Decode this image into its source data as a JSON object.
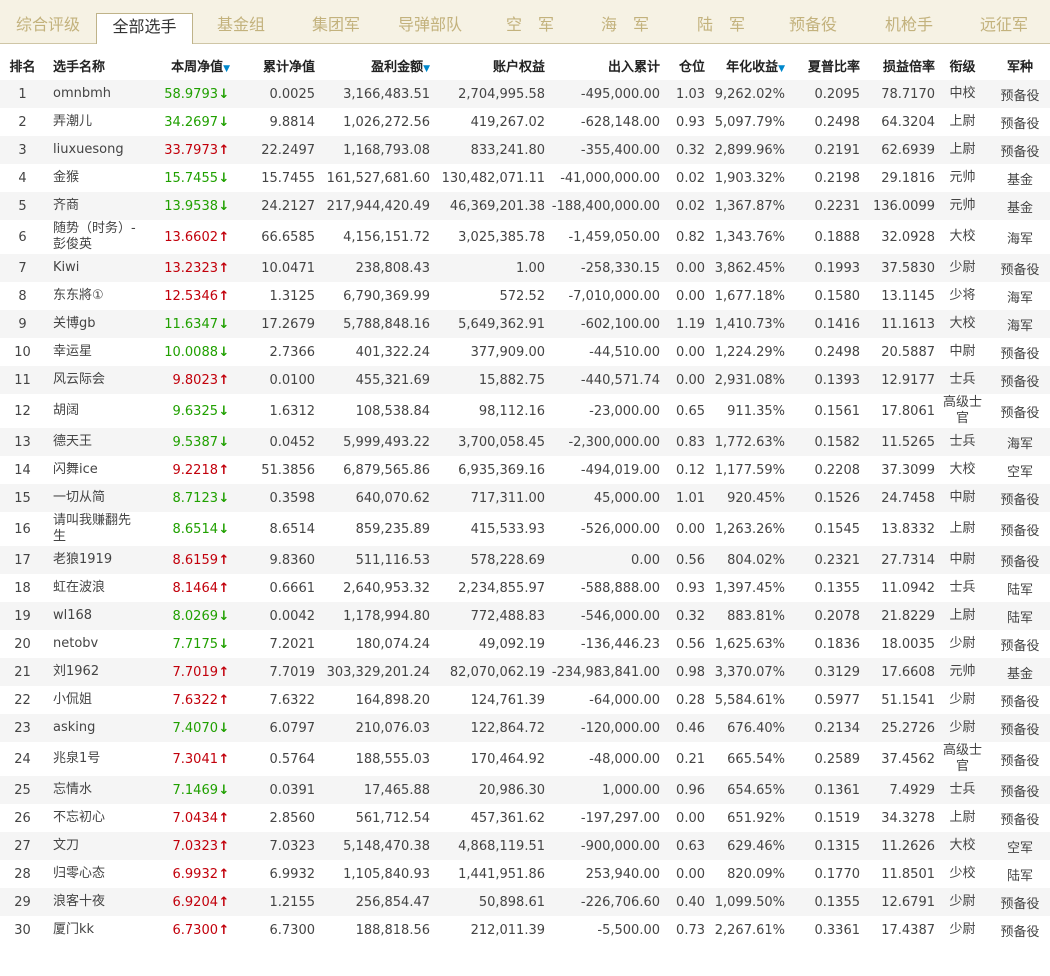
{
  "tabs": [
    {
      "label": "综合评级",
      "active": false
    },
    {
      "label": "全部选手",
      "active": true
    },
    {
      "label": "基金组",
      "active": false
    },
    {
      "label": "集团军",
      "active": false
    },
    {
      "label": "导弹部队",
      "active": false
    },
    {
      "label": "空　军",
      "active": false
    },
    {
      "label": "海　军",
      "active": false
    },
    {
      "label": "陆　军",
      "active": false
    },
    {
      "label": "预备役",
      "active": false
    },
    {
      "label": "机枪手",
      "active": false
    },
    {
      "label": "远征军",
      "active": false
    }
  ],
  "table": {
    "headers": {
      "rank": "排名",
      "name": "选手名称",
      "weekly_nav": "本周净值",
      "cum_nav": "累计净值",
      "profit": "盈利金额",
      "equity": "账户权益",
      "inout": "出入累计",
      "position": "仓位",
      "annual": "年化收益",
      "sharpe": "夏普比率",
      "pl_ratio": "损益倍率",
      "rank_title": "衔级",
      "branch": "军种"
    },
    "sort_icon": "▼",
    "rows": [
      {
        "rank": "1",
        "name": "omnbmh",
        "weekly_nav": "58.9793",
        "trend": "down",
        "cum_nav": "0.0025",
        "profit": "3,166,483.51",
        "equity": "2,704,995.58",
        "inout": "-495,000.00",
        "position": "1.03",
        "annual": "9,262.02%",
        "sharpe": "0.2095",
        "pl_ratio": "78.7170",
        "rank_title": "中校",
        "branch": "预备役"
      },
      {
        "rank": "2",
        "name": "弄潮儿",
        "weekly_nav": "34.2697",
        "trend": "down",
        "cum_nav": "9.8814",
        "profit": "1,026,272.56",
        "equity": "419,267.02",
        "inout": "-628,148.00",
        "position": "0.93",
        "annual": "5,097.79%",
        "sharpe": "0.2498",
        "pl_ratio": "64.3204",
        "rank_title": "上尉",
        "branch": "预备役"
      },
      {
        "rank": "3",
        "name": "liuxuesong",
        "weekly_nav": "33.7973",
        "trend": "up",
        "cum_nav": "22.2497",
        "profit": "1,168,793.08",
        "equity": "833,241.80",
        "inout": "-355,400.00",
        "position": "0.32",
        "annual": "2,899.96%",
        "sharpe": "0.2191",
        "pl_ratio": "62.6939",
        "rank_title": "上尉",
        "branch": "预备役"
      },
      {
        "rank": "4",
        "name": "金猴",
        "weekly_nav": "15.7455",
        "trend": "down",
        "cum_nav": "15.7455",
        "profit": "161,527,681.60",
        "equity": "130,482,071.11",
        "inout": "-41,000,000.00",
        "position": "0.02",
        "annual": "1,903.32%",
        "sharpe": "0.2198",
        "pl_ratio": "29.1816",
        "rank_title": "元帅",
        "branch": "基金"
      },
      {
        "rank": "5",
        "name": "齐商",
        "weekly_nav": "13.9538",
        "trend": "down",
        "cum_nav": "24.2127",
        "profit": "217,944,420.49",
        "equity": "46,369,201.38",
        "inout": "-188,400,000.00",
        "position": "0.02",
        "annual": "1,367.87%",
        "sharpe": "0.2231",
        "pl_ratio": "136.0099",
        "rank_title": "元帅",
        "branch": "基金"
      },
      {
        "rank": "6",
        "name": "随势（时务）-彭俊英",
        "weekly_nav": "13.6602",
        "trend": "up",
        "cum_nav": "66.6585",
        "profit": "4,156,151.72",
        "equity": "3,025,385.78",
        "inout": "-1,459,050.00",
        "position": "0.82",
        "annual": "1,343.76%",
        "sharpe": "0.1888",
        "pl_ratio": "32.0928",
        "rank_title": "大校",
        "branch": "海军"
      },
      {
        "rank": "7",
        "name": "Kiwi",
        "weekly_nav": "13.2323",
        "trend": "up",
        "cum_nav": "10.0471",
        "profit": "238,808.43",
        "equity": "1.00",
        "inout": "-258,330.15",
        "position": "0.00",
        "annual": "3,862.45%",
        "sharpe": "0.1993",
        "pl_ratio": "37.5830",
        "rank_title": "少尉",
        "branch": "预备役"
      },
      {
        "rank": "8",
        "name": "东东將①",
        "weekly_nav": "12.5346",
        "trend": "up",
        "cum_nav": "1.3125",
        "profit": "6,790,369.99",
        "equity": "572.52",
        "inout": "-7,010,000.00",
        "position": "0.00",
        "annual": "1,677.18%",
        "sharpe": "0.1580",
        "pl_ratio": "13.1145",
        "rank_title": "少将",
        "branch": "海军"
      },
      {
        "rank": "9",
        "name": "关博gb",
        "weekly_nav": "11.6347",
        "trend": "down",
        "cum_nav": "17.2679",
        "profit": "5,788,848.16",
        "equity": "5,649,362.91",
        "inout": "-602,100.00",
        "position": "1.19",
        "annual": "1,410.73%",
        "sharpe": "0.1416",
        "pl_ratio": "11.1613",
        "rank_title": "大校",
        "branch": "海军"
      },
      {
        "rank": "10",
        "name": "幸运星",
        "weekly_nav": "10.0088",
        "trend": "down",
        "cum_nav": "2.7366",
        "profit": "401,322.24",
        "equity": "377,909.00",
        "inout": "-44,510.00",
        "position": "0.00",
        "annual": "1,224.29%",
        "sharpe": "0.2498",
        "pl_ratio": "20.5887",
        "rank_title": "中尉",
        "branch": "预备役"
      },
      {
        "rank": "11",
        "name": "风云际会",
        "weekly_nav": "9.8023",
        "trend": "up",
        "cum_nav": "0.0100",
        "profit": "455,321.69",
        "equity": "15,882.75",
        "inout": "-440,571.74",
        "position": "0.00",
        "annual": "2,931.08%",
        "sharpe": "0.1393",
        "pl_ratio": "12.9177",
        "rank_title": "士兵",
        "branch": "预备役"
      },
      {
        "rank": "12",
        "name": "胡阔",
        "weekly_nav": "9.6325",
        "trend": "down",
        "cum_nav": "1.6312",
        "profit": "108,538.84",
        "equity": "98,112.16",
        "inout": "-23,000.00",
        "position": "0.65",
        "annual": "911.35%",
        "sharpe": "0.1561",
        "pl_ratio": "17.8061",
        "rank_title": "高级士官",
        "branch": "预备役"
      },
      {
        "rank": "13",
        "name": "德天王",
        "weekly_nav": "9.5387",
        "trend": "down",
        "cum_nav": "0.0452",
        "profit": "5,999,493.22",
        "equity": "3,700,058.45",
        "inout": "-2,300,000.00",
        "position": "0.83",
        "annual": "1,772.63%",
        "sharpe": "0.1582",
        "pl_ratio": "11.5265",
        "rank_title": "士兵",
        "branch": "海军"
      },
      {
        "rank": "14",
        "name": "闪舞ice",
        "weekly_nav": "9.2218",
        "trend": "up",
        "cum_nav": "51.3856",
        "profit": "6,879,565.86",
        "equity": "6,935,369.16",
        "inout": "-494,019.00",
        "position": "0.12",
        "annual": "1,177.59%",
        "sharpe": "0.2208",
        "pl_ratio": "37.3099",
        "rank_title": "大校",
        "branch": "空军"
      },
      {
        "rank": "15",
        "name": "一切从简",
        "weekly_nav": "8.7123",
        "trend": "down",
        "cum_nav": "0.3598",
        "profit": "640,070.62",
        "equity": "717,311.00",
        "inout": "45,000.00",
        "position": "1.01",
        "annual": "920.45%",
        "sharpe": "0.1526",
        "pl_ratio": "24.7458",
        "rank_title": "中尉",
        "branch": "预备役"
      },
      {
        "rank": "16",
        "name": "请叫我赚翻先生",
        "weekly_nav": "8.6514",
        "trend": "down",
        "cum_nav": "8.6514",
        "profit": "859,235.89",
        "equity": "415,533.93",
        "inout": "-526,000.00",
        "position": "0.00",
        "annual": "1,263.26%",
        "sharpe": "0.1545",
        "pl_ratio": "13.8332",
        "rank_title": "上尉",
        "branch": "预备役"
      },
      {
        "rank": "17",
        "name": "老狼1919",
        "weekly_nav": "8.6159",
        "trend": "up",
        "cum_nav": "9.8360",
        "profit": "511,116.53",
        "equity": "578,228.69",
        "inout": "0.00",
        "position": "0.56",
        "annual": "804.02%",
        "sharpe": "0.2321",
        "pl_ratio": "27.7314",
        "rank_title": "中尉",
        "branch": "预备役"
      },
      {
        "rank": "18",
        "name": "虹在波浪",
        "weekly_nav": "8.1464",
        "trend": "up",
        "cum_nav": "0.6661",
        "profit": "2,640,953.32",
        "equity": "2,234,855.97",
        "inout": "-588,888.00",
        "position": "0.93",
        "annual": "1,397.45%",
        "sharpe": "0.1355",
        "pl_ratio": "11.0942",
        "rank_title": "士兵",
        "branch": "陆军"
      },
      {
        "rank": "19",
        "name": "wl168",
        "weekly_nav": "8.0269",
        "trend": "down",
        "cum_nav": "0.0042",
        "profit": "1,178,994.80",
        "equity": "772,488.83",
        "inout": "-546,000.00",
        "position": "0.32",
        "annual": "883.81%",
        "sharpe": "0.2078",
        "pl_ratio": "21.8229",
        "rank_title": "上尉",
        "branch": "陆军"
      },
      {
        "rank": "20",
        "name": "netobv",
        "weekly_nav": "7.7175",
        "trend": "down",
        "cum_nav": "7.2021",
        "profit": "180,074.24",
        "equity": "49,092.19",
        "inout": "-136,446.23",
        "position": "0.56",
        "annual": "1,625.63%",
        "sharpe": "0.1836",
        "pl_ratio": "18.0035",
        "rank_title": "少尉",
        "branch": "预备役"
      },
      {
        "rank": "21",
        "name": "刘1962",
        "weekly_nav": "7.7019",
        "trend": "up",
        "cum_nav": "7.7019",
        "profit": "303,329,201.24",
        "equity": "82,070,062.19",
        "inout": "-234,983,841.00",
        "position": "0.98",
        "annual": "3,370.07%",
        "sharpe": "0.3129",
        "pl_ratio": "17.6608",
        "rank_title": "元帅",
        "branch": "基金"
      },
      {
        "rank": "22",
        "name": "小侃姐",
        "weekly_nav": "7.6322",
        "trend": "up",
        "cum_nav": "7.6322",
        "profit": "164,898.20",
        "equity": "124,761.39",
        "inout": "-64,000.00",
        "position": "0.28",
        "annual": "5,584.61%",
        "sharpe": "0.5977",
        "pl_ratio": "51.1541",
        "rank_title": "少尉",
        "branch": "预备役"
      },
      {
        "rank": "23",
        "name": "asking",
        "weekly_nav": "7.4070",
        "trend": "down",
        "cum_nav": "6.0797",
        "profit": "210,076.03",
        "equity": "122,864.72",
        "inout": "-120,000.00",
        "position": "0.46",
        "annual": "676.40%",
        "sharpe": "0.2134",
        "pl_ratio": "25.2726",
        "rank_title": "少尉",
        "branch": "预备役"
      },
      {
        "rank": "24",
        "name": "兆泉1号",
        "weekly_nav": "7.3041",
        "trend": "up",
        "cum_nav": "0.5764",
        "profit": "188,555.03",
        "equity": "170,464.92",
        "inout": "-48,000.00",
        "position": "0.21",
        "annual": "665.54%",
        "sharpe": "0.2589",
        "pl_ratio": "37.4562",
        "rank_title": "高级士官",
        "branch": "预备役"
      },
      {
        "rank": "25",
        "name": "忘情水",
        "weekly_nav": "7.1469",
        "trend": "down",
        "cum_nav": "0.0391",
        "profit": "17,465.88",
        "equity": "20,986.30",
        "inout": "1,000.00",
        "position": "0.96",
        "annual": "654.65%",
        "sharpe": "0.1361",
        "pl_ratio": "7.4929",
        "rank_title": "士兵",
        "branch": "预备役"
      },
      {
        "rank": "26",
        "name": "不忘初心",
        "weekly_nav": "7.0434",
        "trend": "up",
        "cum_nav": "2.8560",
        "profit": "561,712.54",
        "equity": "457,361.62",
        "inout": "-197,297.00",
        "position": "0.00",
        "annual": "651.92%",
        "sharpe": "0.1519",
        "pl_ratio": "34.3278",
        "rank_title": "上尉",
        "branch": "预备役"
      },
      {
        "rank": "27",
        "name": "文刀",
        "weekly_nav": "7.0323",
        "trend": "up",
        "cum_nav": "7.0323",
        "profit": "5,148,470.38",
        "equity": "4,868,119.51",
        "inout": "-900,000.00",
        "position": "0.63",
        "annual": "629.46%",
        "sharpe": "0.1315",
        "pl_ratio": "11.2626",
        "rank_title": "大校",
        "branch": "空军"
      },
      {
        "rank": "28",
        "name": "归零心态",
        "weekly_nav": "6.9932",
        "trend": "up",
        "cum_nav": "6.9932",
        "profit": "1,105,840.93",
        "equity": "1,441,951.86",
        "inout": "253,940.00",
        "position": "0.00",
        "annual": "820.09%",
        "sharpe": "0.1770",
        "pl_ratio": "11.8501",
        "rank_title": "少校",
        "branch": "陆军"
      },
      {
        "rank": "29",
        "name": "浪客十夜",
        "weekly_nav": "6.9204",
        "trend": "up",
        "cum_nav": "1.2155",
        "profit": "256,854.47",
        "equity": "50,898.61",
        "inout": "-226,706.60",
        "position": "0.40",
        "annual": "1,099.50%",
        "sharpe": "0.1355",
        "pl_ratio": "12.6791",
        "rank_title": "少尉",
        "branch": "预备役"
      },
      {
        "rank": "30",
        "name": "厦门kk",
        "weekly_nav": "6.7300",
        "trend": "up",
        "cum_nav": "6.7300",
        "profit": "188,818.56",
        "equity": "212,011.39",
        "inout": "-5,500.00",
        "position": "0.73",
        "annual": "2,267.61%",
        "sharpe": "0.3361",
        "pl_ratio": "17.4387",
        "rank_title": "少尉",
        "branch": "预备役"
      }
    ]
  }
}
